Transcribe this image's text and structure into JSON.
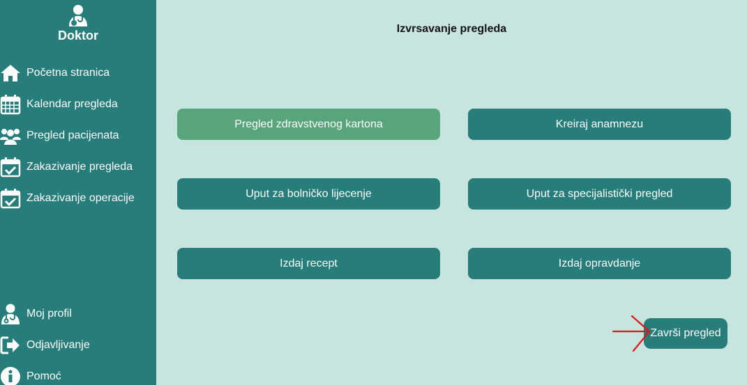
{
  "sidebar": {
    "brand": "Doktor",
    "items": [
      {
        "label": "Početna stranica",
        "icon": "home-icon"
      },
      {
        "label": "Kalendar pregleda",
        "icon": "calendar-icon"
      },
      {
        "label": "Pregled pacijenata",
        "icon": "users-icon"
      },
      {
        "label": "Zakazivanje pregleda",
        "icon": "calendar-check-icon"
      },
      {
        "label": "Zakazivanje operacije",
        "icon": "calendar-check-icon"
      }
    ],
    "bottom_items": [
      {
        "label": "Moj profil",
        "icon": "doctor-icon"
      },
      {
        "label": "Odjavljivanje",
        "icon": "logout-icon"
      },
      {
        "label": "Pomoć",
        "icon": "info-icon"
      }
    ]
  },
  "main": {
    "title": "Izvrsavanje pregleda",
    "buttons": [
      {
        "label": "Pregled zdravstvenog kartona",
        "active": true
      },
      {
        "label": "Kreiraj anamnezu"
      },
      {
        "label": "Uput za bolničko lijecenje"
      },
      {
        "label": "Uput za specijalistički pregled"
      },
      {
        "label": "Izdaj recept"
      },
      {
        "label": "Izdaj opravdanje"
      }
    ],
    "finish_label": "Završi pregled"
  },
  "colors": {
    "sidebar": "#267d79",
    "background": "#c7e5de",
    "button": "#267d79",
    "button_active": "#58a47b",
    "annotation_arrow": "#e0161b"
  }
}
